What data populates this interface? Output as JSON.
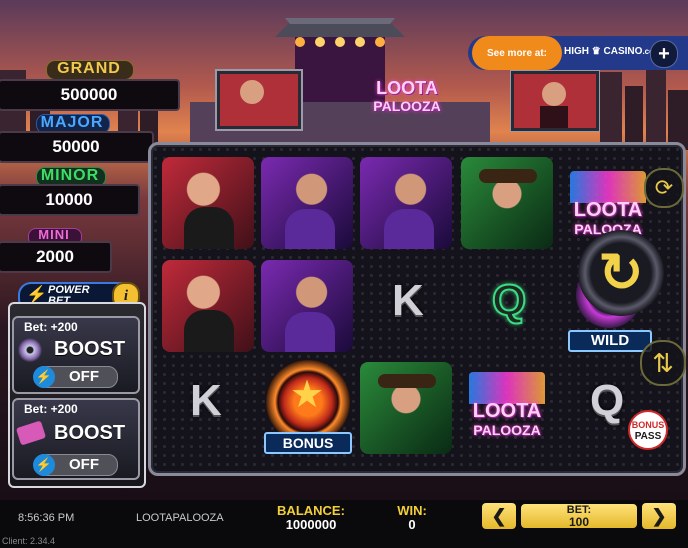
{
  "jackpots": [
    {
      "label": "GRAND",
      "value": "500000",
      "color": "#f2c94c"
    },
    {
      "label": "MAJOR",
      "value": "50000",
      "color": "#4aa8ff"
    },
    {
      "label": "MINOR",
      "value": "10000",
      "color": "#3ddc64"
    },
    {
      "label": "MINI",
      "value": "2000",
      "color": "#f06ad8"
    }
  ],
  "power_bet": {
    "label_1": "POWER",
    "label_2": "BET",
    "info": "i"
  },
  "boosts": [
    {
      "bet": "Bet: +200",
      "label": "BOOST",
      "state": "OFF",
      "icon": "disc-icon"
    },
    {
      "bet": "Bet: +200",
      "label": "BOOST",
      "state": "OFF",
      "icon": "ticket-icon"
    }
  ],
  "promo": {
    "see_more": "See more at:",
    "brand": "HIGH",
    "brand_2": "CASINO",
    "suffix": ".com",
    "plus": "+"
  },
  "logo": {
    "line1": "LOOTA",
    "line2": "PALOOZA"
  },
  "symbols": {
    "wild": "WILD",
    "bonus": "BONUS",
    "k": "K",
    "q": "Q",
    "bonus_pass_1": "BONUS",
    "bonus_pass_2": "PASS"
  },
  "bottom_bar": {
    "time": "8:56:36 PM",
    "game": "LOOTAPALOOZA",
    "balance_label": "BALANCE:",
    "balance_value": "1000000",
    "win_label": "WIN:",
    "win_value": "0",
    "bet_label": "BET:",
    "bet_value": "100",
    "prev": "❮",
    "next": "❯",
    "client": "Client: 2.34.4"
  }
}
